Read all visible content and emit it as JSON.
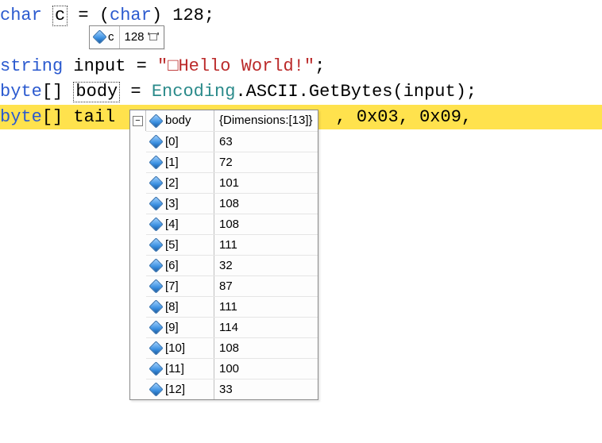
{
  "code": {
    "line1": {
      "kw": "char",
      "var": "c",
      "rest": " = (",
      "cast_kw": "char",
      "rest2": ") 128;"
    },
    "blank": " ",
    "line2": {
      "kw": "string",
      "plain": " input = ",
      "str": "\"□Hello World!\"",
      "semi": ";"
    },
    "line3": {
      "kw": "byte",
      "arr": "[] ",
      "var": "body",
      "eq": " = ",
      "typ": "Encoding",
      "rest": ".ASCII.GetBytes(input);"
    },
    "line4": {
      "kw": "byte",
      "arr": "[] ",
      "var": "tail",
      "trail": ", 0x03, 0x09,"
    }
  },
  "tooltip_c": {
    "name": "c",
    "value": "128 '□'"
  },
  "watch": {
    "expand_glyph": "−",
    "name": "body",
    "summary": "{Dimensions:[13]}",
    "items": [
      {
        "label": "[0]",
        "value": "63"
      },
      {
        "label": "[1]",
        "value": "72"
      },
      {
        "label": "[2]",
        "value": "101"
      },
      {
        "label": "[3]",
        "value": "108"
      },
      {
        "label": "[4]",
        "value": "108"
      },
      {
        "label": "[5]",
        "value": "111"
      },
      {
        "label": "[6]",
        "value": "32"
      },
      {
        "label": "[7]",
        "value": "87"
      },
      {
        "label": "[8]",
        "value": "111"
      },
      {
        "label": "[9]",
        "value": "114"
      },
      {
        "label": "[10]",
        "value": "108"
      },
      {
        "label": "[11]",
        "value": "100"
      },
      {
        "label": "[12]",
        "value": "33"
      }
    ]
  }
}
